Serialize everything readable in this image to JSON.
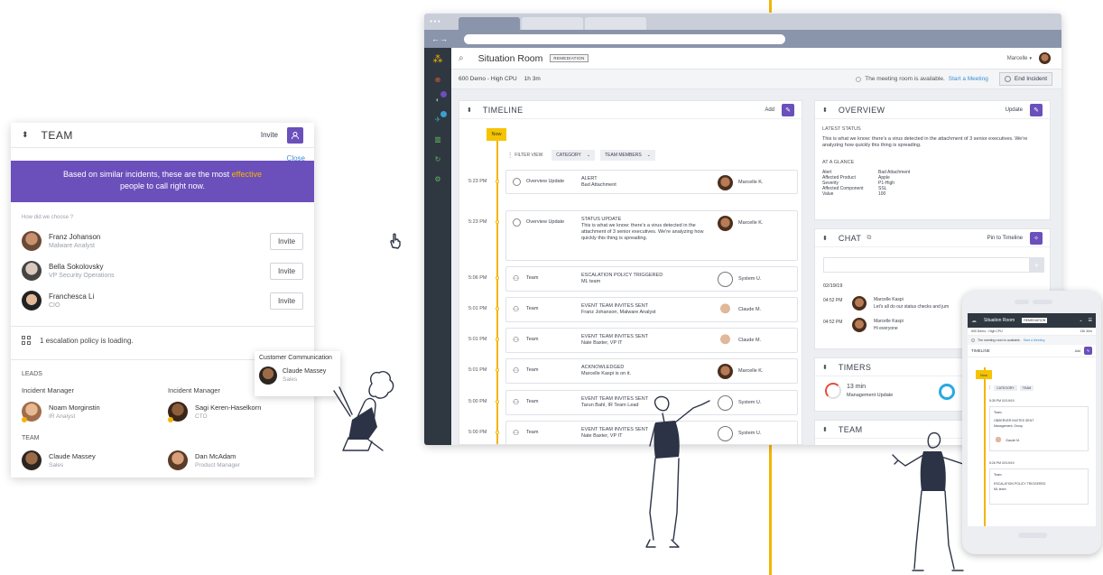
{
  "team_panel": {
    "title": "TEAM",
    "invite_label": "Invite",
    "close_label": "Close",
    "banner_pre": "Based on similar incidents, these are the most ",
    "banner_highlight": "effective",
    "banner_post": "people to call right now.",
    "how_chosen": "How did we choose ?",
    "suggested": [
      {
        "name": "Franz Johanson",
        "role": "Malware Analyst",
        "action": "Invite"
      },
      {
        "name": "Bella Sokolovsky",
        "role": "VP Security Operations",
        "action": "Invite"
      },
      {
        "name": "Franchesca Li",
        "role": "CIO",
        "action": "Invite"
      }
    ],
    "escalation_text": "1 escalation policy is loading.",
    "leads_label": "LEADS",
    "lead_role_1": "Incident Manager",
    "lead_role_2": "Incident Manager",
    "leads": [
      {
        "name": "Noam Morginstin",
        "role": "IR Analyst"
      },
      {
        "name": "Sagi Keren-Haselkorn",
        "role": "CTO"
      }
    ],
    "team_label": "TEAM",
    "team": [
      {
        "name": "Claude Massey",
        "role": "Sales"
      },
      {
        "name": "Dan McAdam",
        "role": "Product Manager"
      }
    ]
  },
  "drag_card": {
    "title": "Customer Communication",
    "name": "Claude Massey",
    "role": "Sales"
  },
  "app": {
    "page_title": "Situation Room",
    "status_badge": "REMEDIATION",
    "user_name": "Marcelle",
    "incident_name": "600 Demo - High CPU",
    "incident_duration": "1h 3m",
    "room_status": "The meeting room is available.",
    "start_meeting": "Start a Meeting",
    "end_incident": "End Incident"
  },
  "timeline": {
    "title": "TIMELINE",
    "add_label": "Add",
    "now_label": "Now",
    "filter_label": "FILTER VIEW",
    "category_label": "CATEGORY",
    "team_members_label": "TEAM MEMBERS",
    "events": [
      {
        "time": "5:23 PM",
        "type": "Overview Update",
        "title": "ALERT",
        "body": "Bad Attachment",
        "user": "Marcelle K."
      },
      {
        "time": "5:23 PM",
        "type": "Overview Update",
        "title": "STATUS UPDATE",
        "body": "This is what we know: there's a virus detected in the attachment of 3 senior executives. We're analyzing how quickly this thing is spreading.",
        "user": "Marcelle K."
      },
      {
        "time": "5:06 PM",
        "type": "Team",
        "title": "ESCALATION POLICY TRIGGERED",
        "body": "ML team",
        "user": "System U."
      },
      {
        "time": "5:01 PM",
        "type": "Team",
        "title": "EVENT TEAM INVITES SENT",
        "body": "Franz Johanson, Malware Analyst",
        "user": "Claude M."
      },
      {
        "time": "5:01 PM",
        "type": "Team",
        "title": "EVENT TEAM INVITES SENT",
        "body": "Nate Baxter, VP IT",
        "user": "Claude M."
      },
      {
        "time": "5:01 PM",
        "type": "Team",
        "title": "ACKNOWLEDGED",
        "body": "Marcelle Kaspi is on it.",
        "user": "Marcelle K."
      },
      {
        "time": "5:00 PM",
        "type": "Team",
        "title": "EVENT TEAM INVITES SENT",
        "body": "Tarun Bahl, IR Team Lead",
        "user": "System U."
      },
      {
        "time": "5:00 PM",
        "type": "Team",
        "title": "EVENT TEAM INVITES SENT",
        "body": "Nate Baxter, VP IT",
        "user": "System U."
      }
    ]
  },
  "overview": {
    "title": "OVERVIEW",
    "update_label": "Update",
    "latest_label": "LATEST STATUS",
    "latest_text": "This is what we know: there's a virus detected in the attachment of 3 senior executives. We're analyzing how quickly this thing is spreading.",
    "glance_label": "AT A GLANCE",
    "glance": [
      {
        "k": "Alert",
        "v": "Bad Attachment"
      },
      {
        "k": "Affected Product",
        "v": "Apple"
      },
      {
        "k": "Severity",
        "v": "P1-High"
      },
      {
        "k": "Affected Component",
        "v": "SSL"
      },
      {
        "k": "Value",
        "v": "100"
      }
    ]
  },
  "chat": {
    "title": "CHAT",
    "pin_label": "Pin to Timeline",
    "date": "02/19/19",
    "messages": [
      {
        "time": "04:52 PM",
        "user": "Marcelle Kaspi",
        "text": "Let's all do our status checks and jum"
      },
      {
        "time": "04:52 PM",
        "user": "Marcelle Kaspi",
        "text": "Hi everyone"
      }
    ]
  },
  "timers": {
    "title": "TIMERS",
    "value": "13 min",
    "label": "Management Update"
  },
  "team_card": {
    "title": "TEAM"
  },
  "phone": {
    "title": "Situation Room",
    "badge": "REMEDIATION",
    "incident": "600 Demo - High CPU",
    "duration": "13h 30m",
    "room_status": "The meeting room is available.",
    "start_meeting": "Start a Meeting",
    "timeline_label": "TIMELINE",
    "add_label": "Add",
    "now_label": "Now",
    "category_label": "CATEGORY",
    "team_label": "TEAM",
    "event1_time": "5:35 PM 02/19/19",
    "event1_type": "Team",
    "event1_title": "OBSERVER INVITES SENT",
    "event1_body": "Management, Group",
    "event1_user": "Claude M.",
    "event2_time": "5:26 PM 02/19/19",
    "event2_type": "Team",
    "event2_title": "ESCALATION POLICY TRIGGERED",
    "event2_body": "ML team"
  },
  "colors": {
    "accent": "#6b4fbb",
    "highlight": "#f5b400",
    "link": "#3d8fd6",
    "sidebar": "#2f3741"
  },
  "icons": [
    "sort-icon",
    "add-user-icon",
    "search-icon",
    "edit-icon",
    "chat-icon",
    "pin-icon",
    "timer-icon",
    "hourglass-icon",
    "avatar-icon"
  ]
}
